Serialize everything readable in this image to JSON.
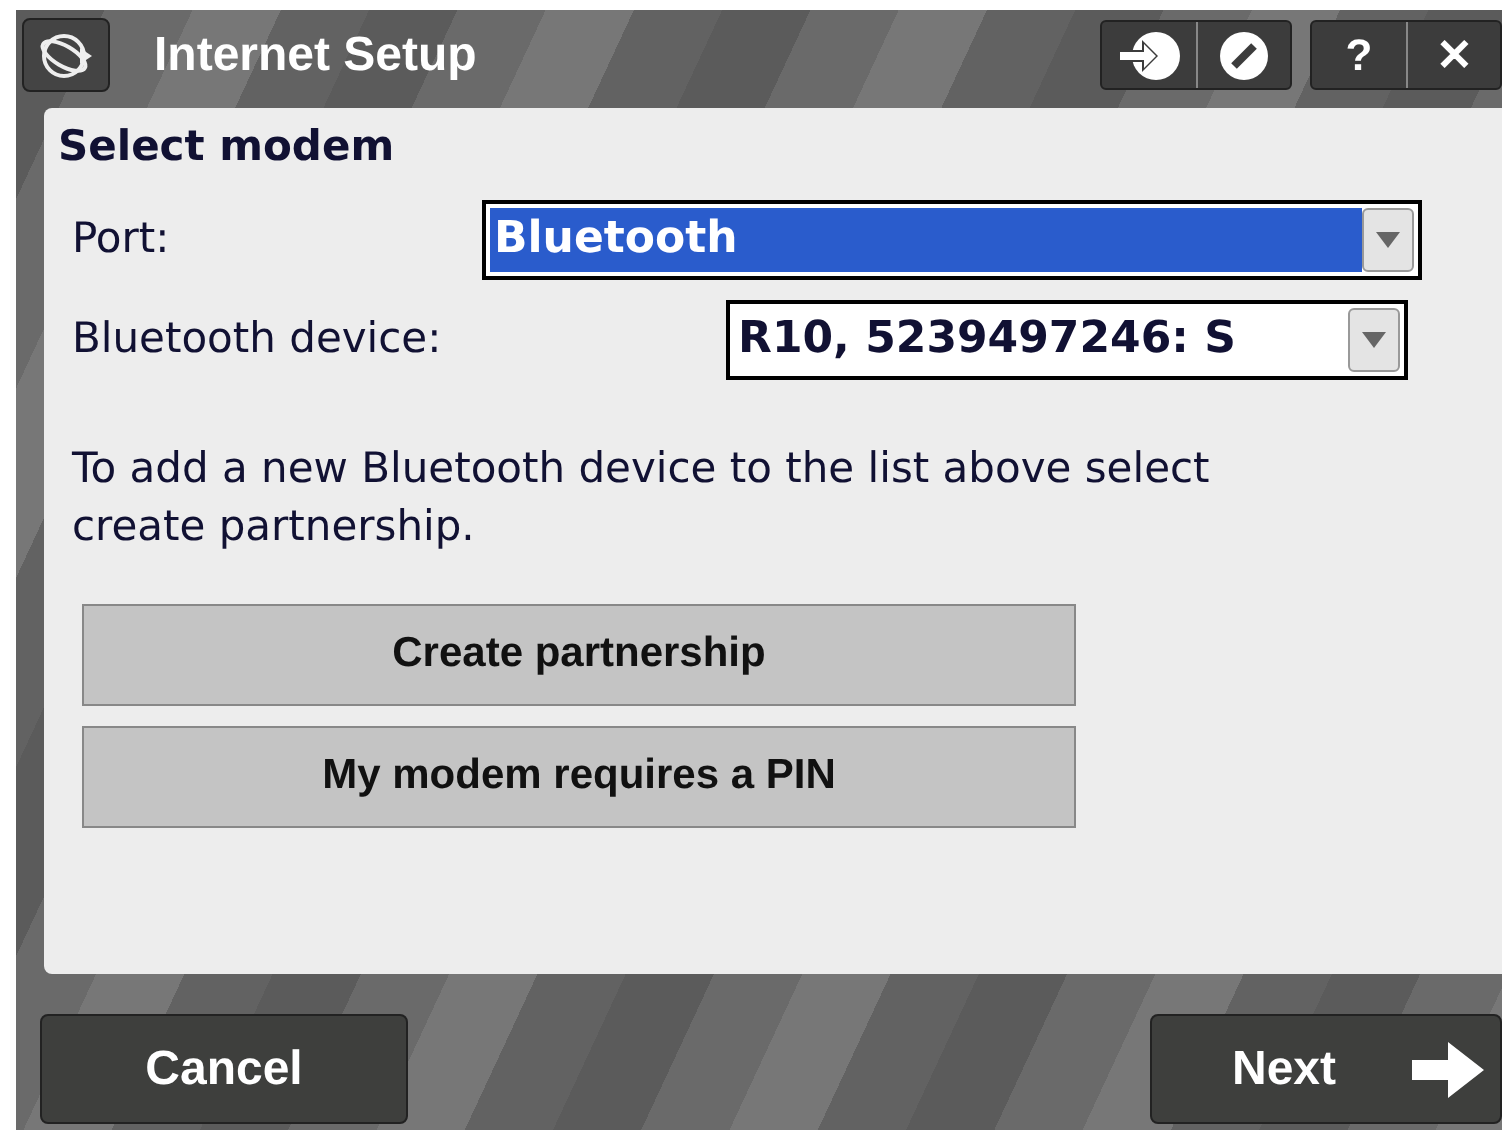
{
  "window": {
    "title": "Internet Setup"
  },
  "title_bar_buttons": [
    {
      "kind": "connect"
    },
    {
      "kind": "stop"
    },
    {
      "kind": "help",
      "label": "?"
    },
    {
      "kind": "close",
      "label": "✕"
    }
  ],
  "section_title": "Select modem",
  "fields": [
    {
      "label": "Port:",
      "value": "Bluetooth",
      "selected": true
    },
    {
      "label": "Bluetooth device:",
      "value": "R10, 5239497246: S",
      "selected": false
    }
  ],
  "info_text": "To add a new Bluetooth device to the list above select create partnership.",
  "buttons": [
    "Create partnership",
    "My modem requires a PIN"
  ],
  "footer": {
    "cancel": "Cancel",
    "next": "Next"
  }
}
